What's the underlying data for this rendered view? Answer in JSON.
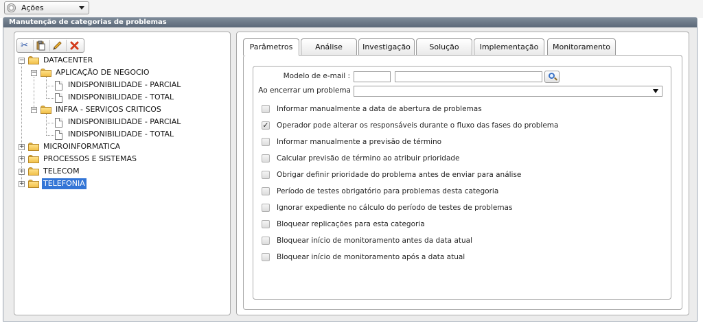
{
  "topbar": {
    "actions_label": "Ações"
  },
  "panel": {
    "title": "Manutenção de categorias de problemas"
  },
  "toolbar": {
    "icons": [
      "scissors-icon",
      "paste-icon",
      "edit-icon",
      "delete-icon"
    ]
  },
  "tree": {
    "nodes": [
      {
        "label": "DATACENTER"
      },
      {
        "label": "APLICAÇÃO DE NEGOCIO"
      },
      {
        "label": "INDISPONIBILIDADE - PARCIAL"
      },
      {
        "label": "INDISPONIBILIDADE - TOTAL"
      },
      {
        "label": "INFRA - SERVIÇOS CRITICOS"
      },
      {
        "label": "INDISPONIBILIDADE - PARCIAL"
      },
      {
        "label": "INDISPONIBILIDADE - TOTAL"
      },
      {
        "label": "MICROINFORMATICA"
      },
      {
        "label": "PROCESSOS E SISTEMAS"
      },
      {
        "label": "TELECOM"
      },
      {
        "label": "TELEFONIA"
      }
    ],
    "selected": "TELEFONIA"
  },
  "tabs": [
    {
      "label": "Parâmetros",
      "active": true
    },
    {
      "label": "Análise"
    },
    {
      "label": "Investigação"
    },
    {
      "label": "Solução"
    },
    {
      "label": "Implementação"
    },
    {
      "label": "Monitoramento"
    }
  ],
  "form": {
    "email_model_label": "Modelo de e-mail :",
    "email_code_value": "",
    "email_name_value": "",
    "close_problem_label": "Ao encerrar um problema",
    "close_problem_value": ""
  },
  "checkboxes": [
    {
      "label": "Informar manualmente a data de abertura de problemas",
      "checked": false
    },
    {
      "label": "Operador pode alterar os responsáveis durante o fluxo das fases do problema",
      "checked": true
    },
    {
      "label": "Informar manualmente a previsão de término",
      "checked": false
    },
    {
      "label": "Calcular previsão de término ao atribuir prioridade",
      "checked": false
    },
    {
      "label": "Obrigar definir prioridade do problema antes de enviar para análise",
      "checked": false
    },
    {
      "label": "Período de testes obrigatório para problemas desta categoria",
      "checked": false
    },
    {
      "label": "Ignorar expediente no cálculo do período de testes de problemas",
      "checked": false
    },
    {
      "label": "Bloquear replicações para esta categoria",
      "checked": false
    },
    {
      "label": "Bloquear início de monitoramento antes da data atual",
      "checked": false
    },
    {
      "label": "Bloquear início de monitoramento após a data atual",
      "checked": false
    }
  ]
}
